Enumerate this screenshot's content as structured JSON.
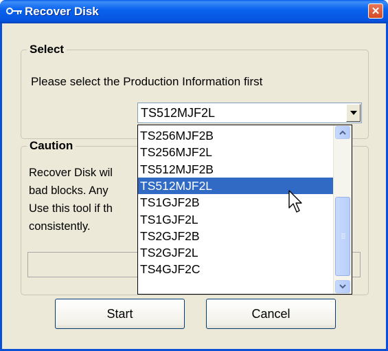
{
  "window": {
    "title": "Recover Disk",
    "close_symbol": "✕",
    "title_icon": "key-icon"
  },
  "select_group": {
    "legend": "Select",
    "instruction": "Please select the Production Information first"
  },
  "combo": {
    "selected_value": "TS512MJF2L",
    "arrow_icon": "chevron-down-icon"
  },
  "dropdown": {
    "options": [
      "TS256MJF2B",
      "TS256MJF2L",
      "TS512MJF2B",
      "TS512MJF2L",
      "TS1GJF2B",
      "TS1GJF2L",
      "TS2GJF2B",
      "TS2GJF2L",
      "TS4GJF2C"
    ],
    "highlighted_index": 3
  },
  "caution_group": {
    "legend": "Caution",
    "lines": [
      "Recover Disk wil",
      "bad blocks. Any",
      "Use this tool if th",
      "consistently."
    ]
  },
  "buttons": {
    "start": "Start",
    "cancel": "Cancel"
  },
  "colors": {
    "titlebar": "#0a5eea",
    "dialog_bg": "#ece9d8",
    "selection": "#316ac5",
    "close_button": "#d44a22"
  }
}
